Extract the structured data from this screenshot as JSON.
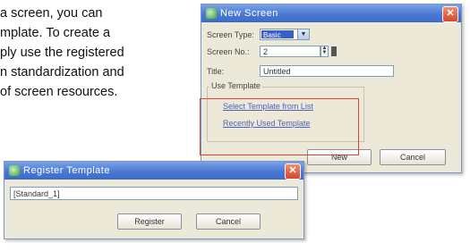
{
  "doc": {
    "lines": [
      "a screen, you can",
      "mplate. To create a",
      "ply use the registered",
      "n standardization and",
      "of screen resources."
    ]
  },
  "new_screen": {
    "title": "New Screen",
    "screen_type_label": "Screen Type:",
    "screen_type_value": "Basic",
    "screen_no_label": "Screen No.:",
    "screen_no_value": "2",
    "title_label": "Title:",
    "title_value": "Untitled",
    "use_template_label": "Use Template",
    "link_select": "Select Template from List",
    "link_recent": "Recently Used Template",
    "new_button": "New",
    "cancel_button": "Cancel"
  },
  "register_template": {
    "title": "Register Template",
    "name_value": "[Standard_1]",
    "register_button": "Register",
    "cancel_button": "Cancel"
  },
  "colors": {
    "titlebar": "#4a79d4",
    "dialog_bg": "#ece9d8",
    "highlight": "#d84040",
    "link": "#4b62b8"
  }
}
